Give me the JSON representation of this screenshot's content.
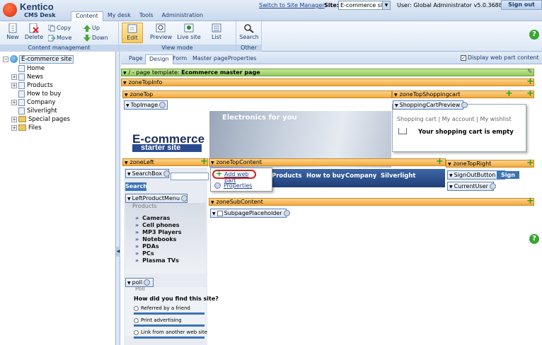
{
  "app": {
    "logo_name": "Kentico",
    "logo_product": "CMS Desk"
  },
  "main_tabs": [
    {
      "label": "Content"
    },
    {
      "label": "My desk"
    },
    {
      "label": "Tools"
    },
    {
      "label": "Administration"
    }
  ],
  "header": {
    "switch_link": "Switch to Site Manager",
    "site_label": "Site:",
    "site_value": "E-commerce site",
    "user_text": "User: Global Administrator  v5.0.3688",
    "signout": "Sign out"
  },
  "toolbar": {
    "new": "New",
    "delete": "Delete",
    "copy": "Copy",
    "move": "Move",
    "up": "Up",
    "down": "Down",
    "group_content": "Content management",
    "edit": "Edit",
    "preview": "Preview",
    "live": "Live site",
    "list": "List",
    "group_view": "View mode",
    "search": "Search",
    "group_other": "Other"
  },
  "tree": {
    "root": "E-commerce site",
    "items": [
      {
        "label": "Home",
        "type": "page",
        "expander": ""
      },
      {
        "label": "News",
        "type": "page",
        "expander": "+"
      },
      {
        "label": "Products",
        "type": "page",
        "expander": "+"
      },
      {
        "label": "How to buy",
        "type": "page",
        "expander": ""
      },
      {
        "label": "Company",
        "type": "page",
        "expander": "+"
      },
      {
        "label": "Silverlight",
        "type": "page",
        "expander": ""
      },
      {
        "label": "Special pages",
        "type": "folder",
        "expander": "+"
      },
      {
        "label": "Files",
        "type": "folder",
        "expander": "+"
      }
    ]
  },
  "subtabs": [
    {
      "label": "Page"
    },
    {
      "label": "Design"
    },
    {
      "label": "Form"
    },
    {
      "label": "Master page"
    },
    {
      "label": "Properties"
    }
  ],
  "display_webpart": "Display web part content",
  "zones": {
    "page_template_prefix": "/ - page template: ",
    "page_template_name": "Ecommerce master page",
    "zoneTopInfo": "zoneTopInfo",
    "zoneTop": "zoneTop",
    "zoneTopShoppingcart": "zoneTopShoppingcart",
    "zoneLeft": "zoneLeft",
    "zoneTopContent": "zoneTopContent",
    "zoneTopRight": "zoneTopRight",
    "zoneSubContent": "zoneSubContent"
  },
  "webparts": {
    "topimage": "TopImage",
    "cartpreview": "ShoppingCartPreview",
    "searchbox": "SearchBox",
    "leftproductmenu": "LeftProductMenu",
    "poll": "poll",
    "signoutbutton": "SignOutButton",
    "currentuser": "CurrentUser",
    "subpageplaceholder": "SubpagePlaceholder"
  },
  "banner": {
    "title": "E-commerce",
    "subtitle": "starter site",
    "tagline": "Electronics for you"
  },
  "cart": {
    "links": "Shopping cart  |  My account  |  My wishlist",
    "empty": "Your shopping cart is empty"
  },
  "search_button": "Search",
  "products": {
    "title": "Products",
    "items": [
      "Cameras",
      "Cell phones",
      "MP3 Players",
      "Notebooks",
      "PDAs",
      "PCs",
      "Plasma TVs"
    ]
  },
  "nav_items": [
    "Products",
    "How to buy",
    "Company",
    "Silverlight"
  ],
  "context_menu": {
    "add": "Add web part",
    "properties": "Properties"
  },
  "signout_small": "Sign out",
  "poll": {
    "title": "Poll",
    "question": "How did you find this site?",
    "options": [
      "Referred by a friend",
      "Print advertising",
      "Link from another web site"
    ]
  }
}
